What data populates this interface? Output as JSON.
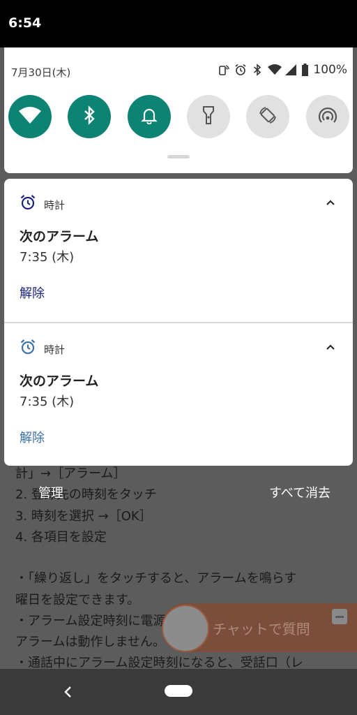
{
  "status_bar": {
    "time": "6:54"
  },
  "quick_settings": {
    "date": "7月30日(木)",
    "battery": "100%",
    "tiles": [
      {
        "icon": "wifi-icon",
        "active": true
      },
      {
        "icon": "bluetooth-icon",
        "active": true
      },
      {
        "icon": "bell-icon",
        "active": true
      },
      {
        "icon": "flashlight-icon",
        "active": false
      },
      {
        "icon": "auto-rotate-icon",
        "active": false
      },
      {
        "icon": "hotspot-icon",
        "active": false
      }
    ]
  },
  "background_page": {
    "lines": [
      "計」→［アラーム］",
      "2. 登録先の時刻をタッチ",
      "3. 時刻を選択 →［OK］",
      "4. 各項目を設定",
      "・「繰り返し」をタッチすると、アラームを鳴らす",
      "曜日を設定できます。",
      "・アラーム設定時刻に電源が入っていない場合は、",
      "アラームは動作しません。",
      "・通話中にアラーム設定時刻になると、受話口（レ"
    ],
    "chat_label": "チャットで質問"
  },
  "notifications": [
    {
      "app": "時計",
      "title": "次のアラーム",
      "text": "7:35 (木)",
      "action": "解除"
    },
    {
      "app": "時計",
      "title": "次のアラーム",
      "text": "7:35 (木)",
      "action": "解除"
    }
  ],
  "footer": {
    "manage": "管理",
    "clear_all": "すべて消去"
  },
  "colors": {
    "tile_active": "#0d8374",
    "tile_inactive": "#e1e1e1",
    "action_dark": "#1a237e",
    "action_light": "#3d6fa8",
    "alarm_icon_dark": "#1a237e",
    "alarm_icon_light": "#3d6fa8"
  }
}
